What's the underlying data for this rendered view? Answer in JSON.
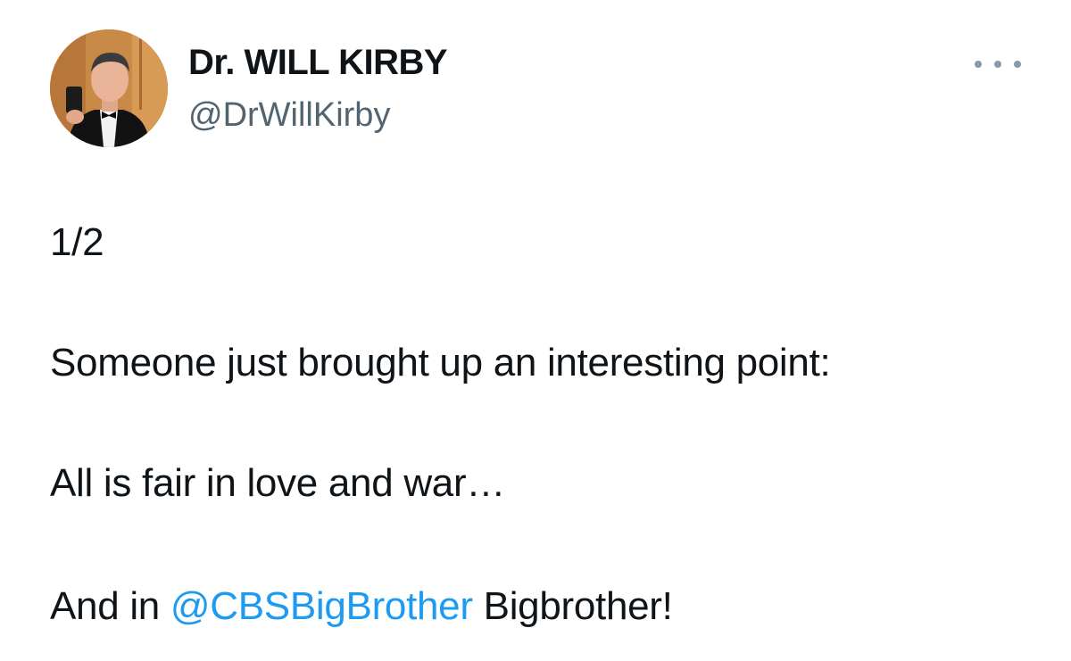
{
  "author": {
    "display_name": "Dr. WILL KIRBY",
    "handle": "@DrWillKirby",
    "avatar_icon": "profile-photo"
  },
  "more_menu": {
    "icon": "more-horizontal-icon"
  },
  "tweet": {
    "line1": "1/2",
    "line2": "Someone just brought up an interesting point:",
    "line3": "All is fair in love and war…",
    "line4_prefix": "And in ",
    "line4_mention": "@CBSBigBrother",
    "line4_suffix": " Bigbrother!"
  },
  "colors": {
    "text": "#0f1419",
    "secondary_text": "#536471",
    "link": "#1d9bf0",
    "background": "#ffffff"
  }
}
